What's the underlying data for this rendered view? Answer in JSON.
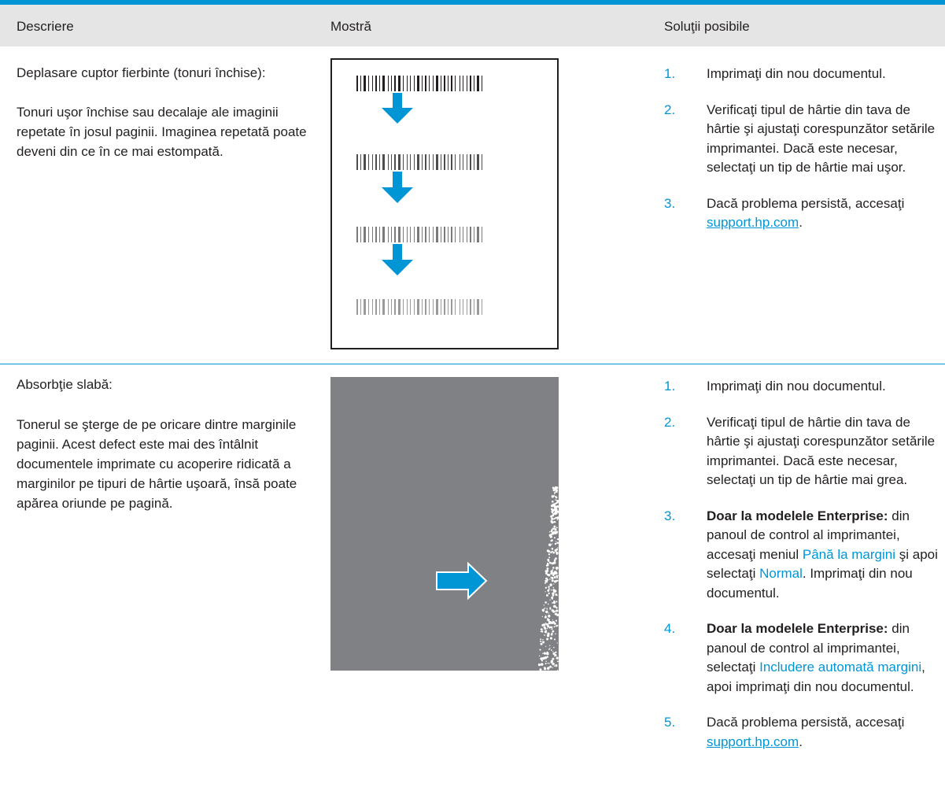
{
  "header": {
    "col_description": "Descriere",
    "col_sample": "Mostră",
    "col_solutions": "Soluţii posibile"
  },
  "rows": [
    {
      "title": "Deplasare cuptor fierbinte (tonuri închise):",
      "description": "Tonuri uşor închise sau decalaje ale imaginii repetate în josul paginii. Imaginea repetată poate deveni din ce în ce mai estompată.",
      "solutions": [
        {
          "num": "1.",
          "text": "Imprimaţi din nou documentul."
        },
        {
          "num": "2.",
          "text": "Verificaţi tipul de hârtie din tava de hârtie şi ajustaţi corespunzător setările imprimantei. Dacă este necesar, selectaţi un tip de hârtie mai uşor."
        },
        {
          "num": "3.",
          "text_before": "Dacă problema persistă, accesaţi ",
          "link": "support.hp.com",
          "text_after": "."
        }
      ]
    },
    {
      "title": "Absorbţie slabă:",
      "description": "Tonerul se şterge de pe oricare dintre marginile paginii. Acest defect este mai des întâlnit documentele imprimate cu acoperire ridicată a marginilor pe tipuri de hârtie uşoară, însă poate apărea oriunde pe pagină.",
      "solutions": [
        {
          "num": "1.",
          "text": "Imprimaţi din nou documentul."
        },
        {
          "num": "2.",
          "text": "Verificaţi tipul de hârtie din tava de hârtie şi ajustaţi corespunzător setările imprimantei. Dacă este necesar, selectaţi un tip de hârtie mai grea."
        },
        {
          "num": "3.",
          "bold": "Doar la modelele Enterprise:",
          "text_a": " din panoul de control al imprimantei, accesaţi meniul ",
          "hl_a": "Până la margini",
          "text_b": " şi apoi selectaţi ",
          "hl_b": "Normal",
          "text_c": ". Imprimaţi din nou documentul."
        },
        {
          "num": "4.",
          "bold": "Doar la modelele Enterprise:",
          "text_a": " din panoul de control al imprimantei, selectaţi ",
          "hl_a": "Includere automată margini",
          "text_b": ", apoi imprimaţi din nou documentul."
        },
        {
          "num": "5.",
          "text_before": "Dacă problema persistă, accesaţi ",
          "link": "support.hp.com",
          "text_after": "."
        }
      ]
    }
  ],
  "colors": {
    "accent": "#0096d6",
    "header_bg": "#e5e5e5",
    "sample_gray": "#808184"
  },
  "icons": [
    "down-arrow-icon",
    "right-arrow-icon",
    "barcode-icon"
  ]
}
